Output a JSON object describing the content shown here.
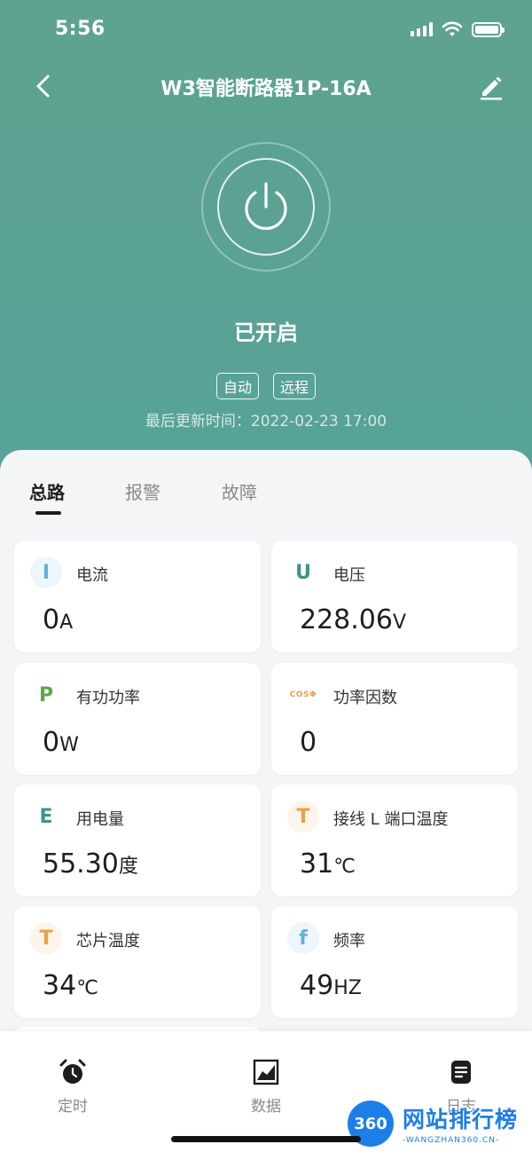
{
  "status_bar": {
    "time": "5:56"
  },
  "header": {
    "title": "W3智能断路器1P-16A"
  },
  "device": {
    "state": "已开启",
    "badges": [
      "自动",
      "远程"
    ],
    "updated": "最后更新时间：2022-02-23 17:00"
  },
  "tabs": [
    {
      "label": "总路",
      "active": true
    },
    {
      "label": "报警",
      "active": false
    },
    {
      "label": "故障",
      "active": false
    }
  ],
  "metrics": [
    {
      "icon": "I",
      "label": "电流",
      "value": "0",
      "unit": "A",
      "color": "#5fb0e0",
      "bg": "#eef6fc"
    },
    {
      "icon": "U",
      "label": "电压",
      "value": "228.06",
      "unit": "V",
      "color": "#3d948a",
      "bg": "#ffffff"
    },
    {
      "icon": "P",
      "label": "有功功率",
      "value": "0",
      "unit": "W",
      "color": "#59a84a",
      "bg": "#ffffff"
    },
    {
      "icon": "COSΦ",
      "label": "功率因数",
      "value": "0",
      "unit": "",
      "color": "#e9a24a",
      "bg": "#ffffff"
    },
    {
      "icon": "E",
      "label": "用电量",
      "value": "55.30",
      "unit": "度",
      "color": "#3d948a",
      "bg": "#ffffff"
    },
    {
      "icon": "T",
      "label": "接线 L 端口温度",
      "value": "31",
      "unit": "℃",
      "color": "#e9a24a",
      "bg": "#fdf4ea"
    },
    {
      "icon": "T",
      "label": "芯片温度",
      "value": "34",
      "unit": "℃",
      "color": "#e9a24a",
      "bg": "#fdf4ea"
    },
    {
      "icon": "f",
      "label": "频率",
      "value": "49",
      "unit": "HZ",
      "color": "#5fb0e0",
      "bg": "#eef6fc"
    }
  ],
  "tabbar": [
    {
      "label": "定时",
      "icon": "alarm-clock-icon"
    },
    {
      "label": "数据",
      "icon": "chart-icon"
    },
    {
      "label": "日志",
      "icon": "log-icon"
    }
  ],
  "watermark": {
    "logo": "360",
    "text": "网站排行榜",
    "sub": "-WANGZHAN360.CN-"
  }
}
